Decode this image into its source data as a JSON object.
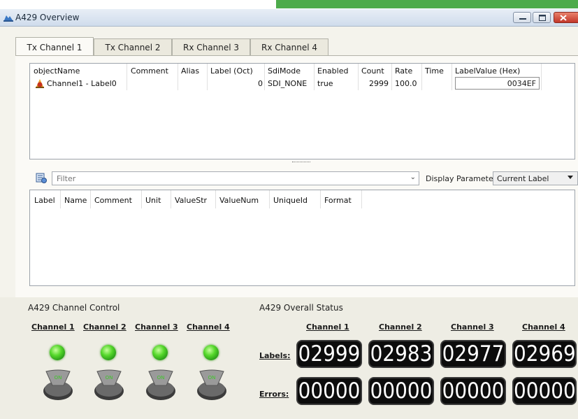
{
  "window": {
    "title": "A429 Overview"
  },
  "tabs": [
    "Tx Channel 1",
    "Tx Channel 2",
    "Rx Channel 3",
    "Rx Channel 4"
  ],
  "colors": {
    "accent_strip": "#4dab4b",
    "led_on": "#55d72b",
    "counter_bg": "#0c0c0c"
  },
  "table1": {
    "headers": [
      "objectName",
      "Comment",
      "Alias",
      "Label (Oct)",
      "SdiMode",
      "Enabled",
      "Count",
      "Rate",
      "Time",
      "LabelValue (Hex)"
    ],
    "row": {
      "icon": "channel-object-icon",
      "objectName": "Channel1 - Label0",
      "comment": "",
      "alias": "",
      "label_oct": "0",
      "sdi_mode": "SDI_NONE",
      "enabled": "true",
      "count": "2999",
      "rate": "100.0",
      "time": "",
      "label_value_hex": "0034EF"
    }
  },
  "filter": {
    "placeholder": "Filter",
    "display_label": "Display Parameters of:",
    "display_value": "Current Label"
  },
  "table2": {
    "headers": [
      "Label",
      "Name",
      "Comment",
      "Unit",
      "ValueStr",
      "ValueNum",
      "UniqueId",
      "Format"
    ]
  },
  "channel_control": {
    "title": "A429 Channel Control",
    "channels": [
      "Channel 1",
      "Channel 2",
      "Channel 3",
      "Channel 4"
    ],
    "switch_label": "ON",
    "led_state": [
      "on",
      "on",
      "on",
      "on"
    ]
  },
  "overall_status": {
    "title": "A429 Overall Status",
    "channels": [
      "Channel 1",
      "Channel 2",
      "Channel 3",
      "Channel 4"
    ],
    "labels_row": "Labels:",
    "errors_row": "Errors:",
    "labels": [
      "02999",
      "02983",
      "02977",
      "02969"
    ],
    "errors": [
      "00000",
      "00000",
      "00000",
      "00000"
    ]
  }
}
